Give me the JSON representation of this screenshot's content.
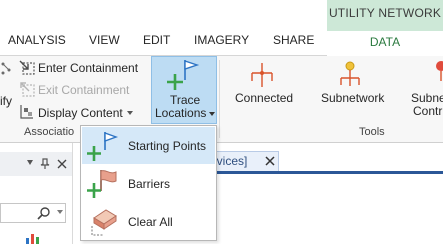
{
  "ribbon_tabs": {
    "contextual_group": "UTILITY NETWORK",
    "analysis": "ANALYSIS",
    "view": "VIEW",
    "edit": "EDIT",
    "imagery": "IMAGERY",
    "share": "SHARE",
    "data": "DATA"
  },
  "association_group": {
    "identify_partial": "ify",
    "enter_containment": "Enter Containment",
    "exit_containment": "Exit Containment",
    "display_content": "Display Content",
    "group_label_partial": "Associatio"
  },
  "tools_group": {
    "trace_locations_line1": "Trace",
    "trace_locations_line2": "Locations",
    "connected": "Connected",
    "subnetwork": "Subnetwork",
    "subnet_partial_line1": "Subne",
    "subnet_partial_line2": "Contr",
    "group_label": "Tools"
  },
  "trace_locations_menu": {
    "items": [
      {
        "label": "Starting Points",
        "icon": "starting-point-flag-icon"
      },
      {
        "label": "Barriers",
        "icon": "barrier-flag-icon"
      },
      {
        "label": "Clear All",
        "icon": "eraser-icon"
      }
    ]
  },
  "map_tab": {
    "label_partial": "ervices]"
  },
  "colors": {
    "contextual_header": "#cde8d7",
    "data_tab_text": "#2b7a3f",
    "trace_button_active": "#bddcf3",
    "menu_hover": "#d5e8f8",
    "green_plus": "#3aa34a",
    "flag_blue": "#2d74c4",
    "barrier_flag": "#e8a08c"
  }
}
